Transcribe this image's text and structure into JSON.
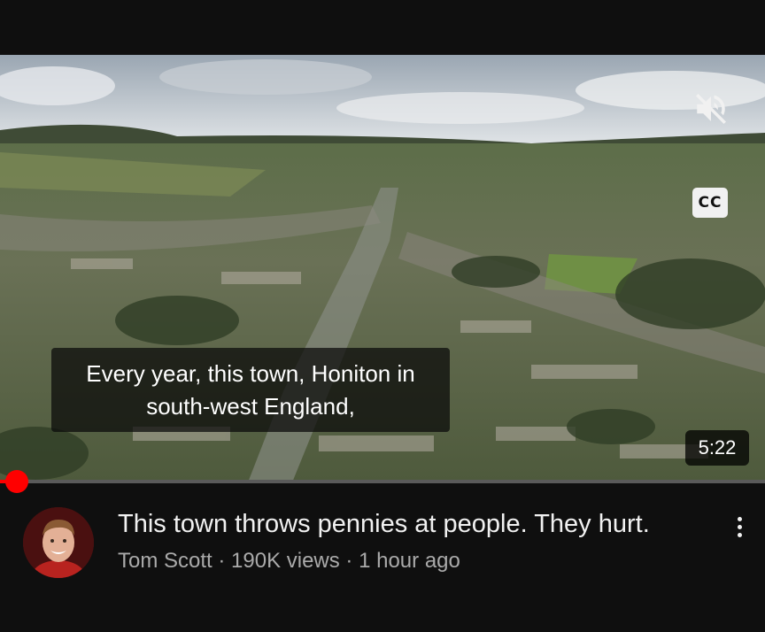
{
  "player": {
    "caption_line1": "Every year, this town, Honiton in",
    "caption_line2": "south-west England,",
    "cc_label": "CC",
    "duration": "5:22",
    "progress_fraction": 0.022,
    "mute_icon": "volume-muted-icon"
  },
  "video": {
    "title": "This town throws pennies at people. They hurt.",
    "channel": "Tom Scott",
    "views": "190K views",
    "published": "1 hour ago",
    "separator": " · "
  },
  "colors": {
    "accent": "#ff0000",
    "background": "#0f0f0f",
    "meta_text": "#aaaaaa"
  }
}
